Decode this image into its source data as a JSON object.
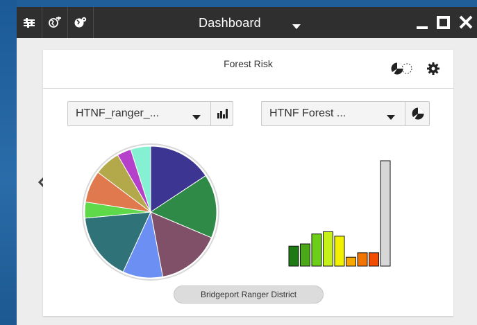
{
  "window": {
    "title": "Dashboard",
    "toolbar_icons": [
      "sliders-icon",
      "globe-add-icon",
      "globe-settings-icon"
    ],
    "controls": [
      "minimize-icon",
      "maximize-icon",
      "close-icon"
    ]
  },
  "card": {
    "title": "Forest Risk",
    "header_icons": [
      "pie-chart-toggle-icon",
      "gear-icon"
    ]
  },
  "dropdowns": {
    "left": {
      "label": "HTNF_ranger_...",
      "icon": "bar-chart-icon"
    },
    "right": {
      "label": "HTNF Forest ...",
      "icon": "pie-chart-icon"
    }
  },
  "district": "Bridgeport Ranger District",
  "navigation": {
    "prev": "chevron-left-icon",
    "next": "chevron-right-icon"
  },
  "chart_data": [
    {
      "type": "pie",
      "slices": [
        {
          "value": 16.0,
          "color": "#3d3592"
        },
        {
          "value": 16.0,
          "color": "#2f8a48"
        },
        {
          "value": 16.0,
          "color": "#7f5068"
        },
        {
          "value": 10.0,
          "color": "#6b8ff2"
        },
        {
          "value": 17.0,
          "color": "#2f7378"
        },
        {
          "value": 4.0,
          "color": "#5fd84a"
        },
        {
          "value": 8.0,
          "color": "#e07a4e"
        },
        {
          "value": 6.5,
          "color": "#b3a84a"
        },
        {
          "value": 3.5,
          "color": "#b540c9"
        },
        {
          "value": 5.0,
          "color": "#86f0d2"
        }
      ]
    },
    {
      "type": "bar",
      "values": [
        1.8,
        2.0,
        2.9,
        3.1,
        2.7,
        0.8,
        1.2,
        1.2,
        9.5
      ],
      "colors": [
        "#1e7a14",
        "#4aa819",
        "#6cce18",
        "#c6f01a",
        "#f2f200",
        "#f7a800",
        "#f27400",
        "#f24c00",
        "#d7d7d7"
      ],
      "ylim": [
        0,
        10
      ]
    }
  ]
}
